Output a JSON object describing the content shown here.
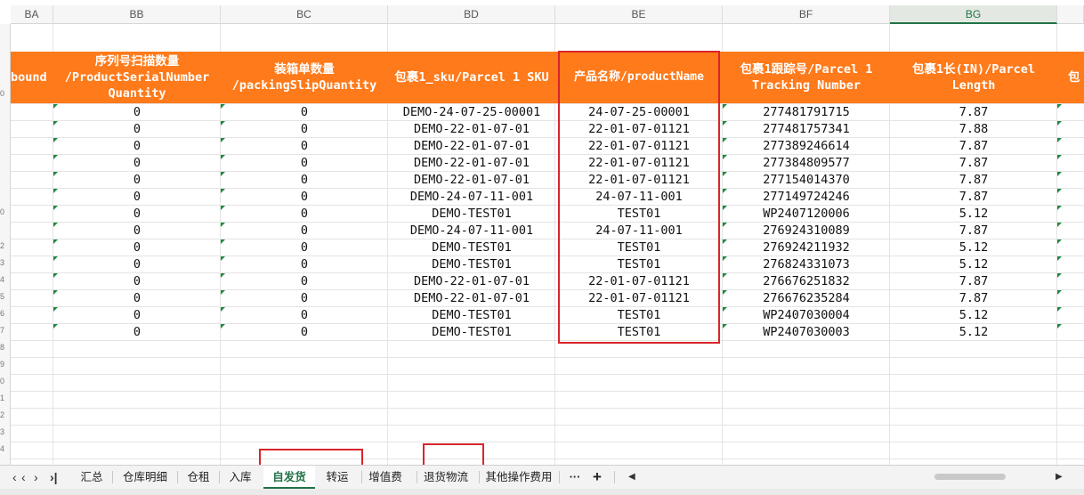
{
  "columns": [
    "BA",
    "BB",
    "BC",
    "BD",
    "BE",
    "BF",
    "BG"
  ],
  "selected_column": "BG",
  "headers": {
    "ba": "bound",
    "bb": "序列号扫描数量 /ProductSerialNumber Quantity",
    "bc": "装箱单数量 /packingSlipQuantity",
    "bd": "包裹1_sku/Parcel 1 SKU",
    "be": "产品名称/productName",
    "bf": "包裹1跟踪号/Parcel 1 Tracking Number",
    "bg": "包裹1长(IN)/Parcel Length",
    "bh_partial": "包"
  },
  "row_numbers": [
    "0",
    "",
    "",
    "",
    "",
    "",
    "",
    "0",
    "",
    "2",
    "3",
    "4",
    "5",
    "6",
    "7",
    "8",
    "9",
    "0",
    "1",
    "2",
    "3",
    "4"
  ],
  "rows": [
    {
      "bb": "0",
      "bc": "0",
      "bd": "DEMO-24-07-25-00001",
      "be": "24-07-25-00001",
      "bf": "277481791715",
      "bg": "7.87"
    },
    {
      "bb": "0",
      "bc": "0",
      "bd": "DEMO-22-01-07-01",
      "be": "22-01-07-01121",
      "bf": "277481757341",
      "bg": "7.88"
    },
    {
      "bb": "0",
      "bc": "0",
      "bd": "DEMO-22-01-07-01",
      "be": "22-01-07-01121",
      "bf": "277389246614",
      "bg": "7.87"
    },
    {
      "bb": "0",
      "bc": "0",
      "bd": "DEMO-22-01-07-01",
      "be": "22-01-07-01121",
      "bf": "277384809577",
      "bg": "7.87"
    },
    {
      "bb": "0",
      "bc": "0",
      "bd": "DEMO-22-01-07-01",
      "be": "22-01-07-01121",
      "bf": "277154014370",
      "bg": "7.87"
    },
    {
      "bb": "0",
      "bc": "0",
      "bd": "DEMO-24-07-11-001",
      "be": "24-07-11-001",
      "bf": "277149724246",
      "bg": "7.87"
    },
    {
      "bb": "0",
      "bc": "0",
      "bd": "DEMO-TEST01",
      "be": "TEST01",
      "bf": "WP2407120006",
      "bg": "5.12"
    },
    {
      "bb": "0",
      "bc": "0",
      "bd": "DEMO-24-07-11-001",
      "be": "24-07-11-001",
      "bf": "276924310089",
      "bg": "7.87"
    },
    {
      "bb": "0",
      "bc": "0",
      "bd": "DEMO-TEST01",
      "be": "TEST01",
      "bf": "276924211932",
      "bg": "5.12"
    },
    {
      "bb": "0",
      "bc": "0",
      "bd": "DEMO-TEST01",
      "be": "TEST01",
      "bf": "276824331073",
      "bg": "5.12"
    },
    {
      "bb": "0",
      "bc": "0",
      "bd": "DEMO-22-01-07-01",
      "be": "22-01-07-01121",
      "bf": "276676251832",
      "bg": "7.87"
    },
    {
      "bb": "0",
      "bc": "0",
      "bd": "DEMO-22-01-07-01",
      "be": "22-01-07-01121",
      "bf": "276676235284",
      "bg": "7.87"
    },
    {
      "bb": "0",
      "bc": "0",
      "bd": "DEMO-TEST01",
      "be": "TEST01",
      "bf": "WP2407030004",
      "bg": "5.12"
    },
    {
      "bb": "0",
      "bc": "0",
      "bd": "DEMO-TEST01",
      "be": "TEST01",
      "bf": "WP2407030003",
      "bg": "5.12"
    }
  ],
  "sheet_nav": {
    "first": "❮",
    "prev": "❮",
    "next": "❯",
    "last": "❯|"
  },
  "tabs": [
    {
      "label": "汇总"
    },
    {
      "label": "仓库明细"
    },
    {
      "label": "仓租"
    },
    {
      "label": "入库"
    },
    {
      "label": "自发货"
    },
    {
      "label": "转运"
    },
    {
      "label": "增值费"
    },
    {
      "label": "退货物流"
    },
    {
      "label": "其他操作费用"
    }
  ],
  "active_tab": "自发货",
  "tab_more": "···",
  "tab_add": "+",
  "colors": {
    "header_bg": "#ff7a1a",
    "highlight_box": "#d8252b",
    "active_tab": "#217346"
  }
}
